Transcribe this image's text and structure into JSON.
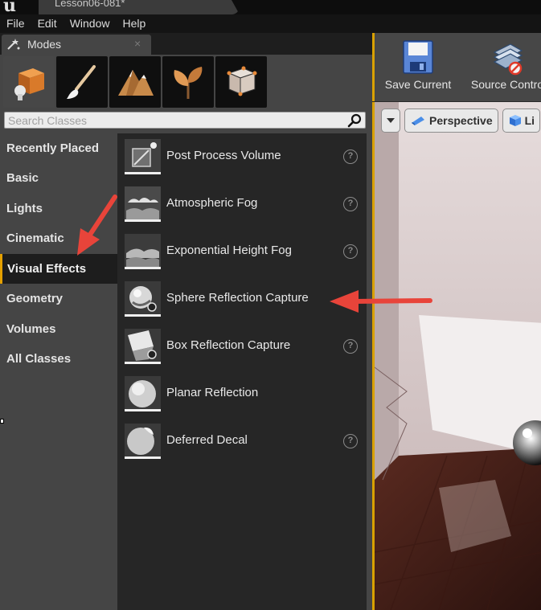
{
  "window": {
    "title": "Lesson06-081*"
  },
  "menubar": {
    "items": [
      "File",
      "Edit",
      "Window",
      "Help"
    ]
  },
  "modes": {
    "tab_label": "Modes",
    "mode_icons": [
      "place-mode",
      "paint-mode",
      "landscape-mode",
      "foliage-mode",
      "geometry-mode"
    ],
    "search_placeholder": "Search Classes",
    "categories": [
      "Recently Placed",
      "Basic",
      "Lights",
      "Cinematic",
      "Visual Effects",
      "Geometry",
      "Volumes",
      "All Classes"
    ],
    "selected_category": "Visual Effects",
    "assets": [
      {
        "label": "Post Process Volume",
        "icon": "post-process-volume-icon",
        "help": true
      },
      {
        "label": "Atmospheric Fog",
        "icon": "atmospheric-fog-icon",
        "help": true
      },
      {
        "label": "Exponential Height Fog",
        "icon": "exponential-height-fog-icon",
        "help": true
      },
      {
        "label": "Sphere Reflection Capture",
        "icon": "sphere-reflection-capture-icon",
        "help": false
      },
      {
        "label": "Box Reflection Capture",
        "icon": "box-reflection-capture-icon",
        "help": true
      },
      {
        "label": "Planar Reflection",
        "icon": "planar-reflection-icon",
        "help": false
      },
      {
        "label": "Deferred Decal",
        "icon": "deferred-decal-icon",
        "help": true
      }
    ]
  },
  "toolbar": {
    "save_label": "Save Current",
    "source_control_label": "Source Contro"
  },
  "viewport": {
    "view_mode": "Perspective",
    "lit_label": "Li"
  },
  "annotations": {
    "arrow_color": "#e8443a"
  },
  "colors": {
    "accent": "#d9a100",
    "selected_border": "#e4a000"
  }
}
